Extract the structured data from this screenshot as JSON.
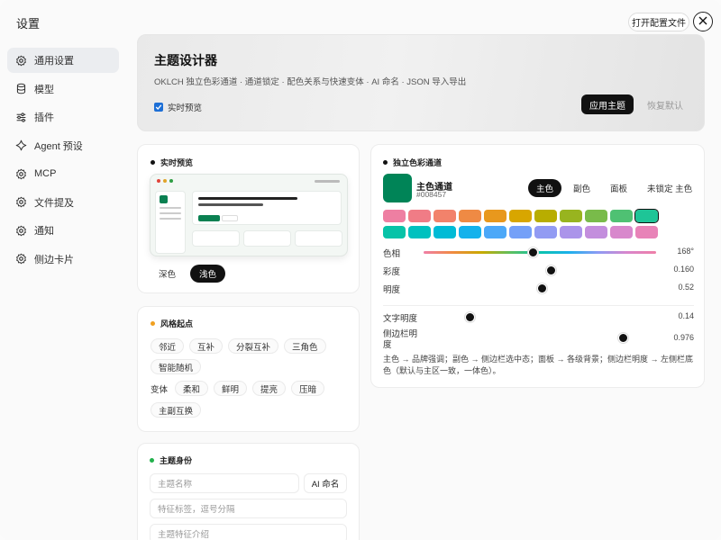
{
  "sidebar": {
    "title": "设置",
    "items": [
      {
        "label": "通用设置",
        "icon": "gear-icon",
        "active": true
      },
      {
        "label": "模型",
        "icon": "database-icon"
      },
      {
        "label": "插件",
        "icon": "sliders-icon"
      },
      {
        "label": "Agent 预设",
        "icon": "agent-icon"
      },
      {
        "label": "MCP",
        "icon": "gear-icon"
      },
      {
        "label": "文件提及",
        "icon": "gear-icon"
      },
      {
        "label": "通知",
        "icon": "gear-icon"
      },
      {
        "label": "侧边卡片",
        "icon": "gear-icon"
      }
    ]
  },
  "header": {
    "open_config": "打开配置文件",
    "close_icon": "close-icon"
  },
  "hero": {
    "title": "主题设计器",
    "subtitle": "OKLCH 独立色彩通道 · 通道锁定 · 配色关系与快速变体 · AI 命名 · JSON 导入导出",
    "live_preview": "实时预览",
    "live_preview_checked": true,
    "apply": "应用主题",
    "reset": "恢复默认"
  },
  "preview": {
    "title": "实时预览",
    "modes": [
      "深色",
      "浅色"
    ],
    "active_mode": "浅色"
  },
  "style": {
    "title": "风格起点",
    "chips": [
      "邻近",
      "互补",
      "分裂互补",
      "三角色",
      "智能随机"
    ],
    "variant_label": "变体",
    "variants": [
      "柔和",
      "鲜明",
      "提亮",
      "压暗"
    ],
    "swap": "主副互换"
  },
  "identity": {
    "title": "主题身份",
    "name_placeholder": "主题名称",
    "ai_name": "AI 命名",
    "tags_placeholder": "特征标签，逗号分隔",
    "desc_placeholder": "主题特征介绍"
  },
  "channel": {
    "title": "独立色彩通道",
    "name": "主色通道",
    "hex": "#008457",
    "tabs": [
      "主色",
      "副色",
      "面板",
      "未锁定 主色"
    ],
    "active_tab": "主色",
    "palette_row1": [
      "#ee7fa2",
      "#f07c86",
      "#f2826b",
      "#ef8a44",
      "#e8981d",
      "#d8a600",
      "#b8ad00",
      "#98b41f",
      "#79bb4a",
      "#4fc173",
      "#1ec597"
    ],
    "palette_row2": [
      "#07c3a8",
      "#00c1bf",
      "#00bbd6",
      "#14b2ec",
      "#4ca8f8",
      "#74a0f8",
      "#929bf3",
      "#ab94ea",
      "#c38edd",
      "#d888cc",
      "#e883b8"
    ],
    "selected_swatch": 10,
    "sliders": {
      "hue": {
        "label": "色相",
        "value": "168°",
        "pos": 0.47
      },
      "chroma": {
        "label": "彩度",
        "value": "0.160",
        "pos": 0.55
      },
      "lightness": {
        "label": "明度",
        "value": "0.52",
        "pos": 0.51
      },
      "text_lightness": {
        "label": "文字明度",
        "value": "0.14",
        "pos": 0.2
      },
      "sidebar_lightness": {
        "label": "侧边栏明度",
        "value": "0.976",
        "pos": 0.86
      }
    },
    "note": "主色 → 品牌强调；副色 → 侧边栏选中态；面板 → 各级背景；侧边栏明度 → 左侧栏底色（默认与主区一致，一体色）。"
  },
  "colors": {
    "brand": "#008457",
    "dark": "#111111",
    "check": "#1d6fd6"
  }
}
